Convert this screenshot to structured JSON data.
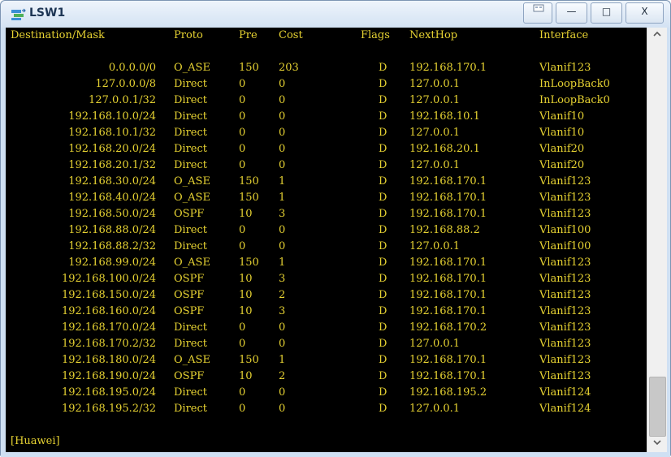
{
  "window": {
    "title": "LSW1",
    "controls": {
      "minimize": "—",
      "maximize": "□",
      "close": "X"
    }
  },
  "colors": {
    "terminal_bg": "#000000",
    "terminal_text": "#e6d232",
    "titlebar": "#dce8f5"
  },
  "routing_table": {
    "headers": [
      "Destination/Mask",
      "Proto",
      "Pre",
      "Cost",
      "Flags",
      "NextHop",
      "Interface"
    ],
    "rows": [
      [
        "0.0.0.0/0",
        "O_ASE",
        "150",
        "203",
        "D",
        "192.168.170.1",
        "Vlanif123"
      ],
      [
        "127.0.0.0/8",
        "Direct",
        "0",
        "0",
        "D",
        "127.0.0.1",
        "InLoopBack0"
      ],
      [
        "127.0.0.1/32",
        "Direct",
        "0",
        "0",
        "D",
        "127.0.0.1",
        "InLoopBack0"
      ],
      [
        "192.168.10.0/24",
        "Direct",
        "0",
        "0",
        "D",
        "192.168.10.1",
        "Vlanif10"
      ],
      [
        "192.168.10.1/32",
        "Direct",
        "0",
        "0",
        "D",
        "127.0.0.1",
        "Vlanif10"
      ],
      [
        "192.168.20.0/24",
        "Direct",
        "0",
        "0",
        "D",
        "192.168.20.1",
        "Vlanif20"
      ],
      [
        "192.168.20.1/32",
        "Direct",
        "0",
        "0",
        "D",
        "127.0.0.1",
        "Vlanif20"
      ],
      [
        "192.168.30.0/24",
        "O_ASE",
        "150",
        "1",
        "D",
        "192.168.170.1",
        "Vlanif123"
      ],
      [
        "192.168.40.0/24",
        "O_ASE",
        "150",
        "1",
        "D",
        "192.168.170.1",
        "Vlanif123"
      ],
      [
        "192.168.50.0/24",
        "OSPF",
        "10",
        "3",
        "D",
        "192.168.170.1",
        "Vlanif123"
      ],
      [
        "192.168.88.0/24",
        "Direct",
        "0",
        "0",
        "D",
        "192.168.88.2",
        "Vlanif100"
      ],
      [
        "192.168.88.2/32",
        "Direct",
        "0",
        "0",
        "D",
        "127.0.0.1",
        "Vlanif100"
      ],
      [
        "192.168.99.0/24",
        "O_ASE",
        "150",
        "1",
        "D",
        "192.168.170.1",
        "Vlanif123"
      ],
      [
        "192.168.100.0/24",
        "OSPF",
        "10",
        "3",
        "D",
        "192.168.170.1",
        "Vlanif123"
      ],
      [
        "192.168.150.0/24",
        "OSPF",
        "10",
        "2",
        "D",
        "192.168.170.1",
        "Vlanif123"
      ],
      [
        "192.168.160.0/24",
        "OSPF",
        "10",
        "3",
        "D",
        "192.168.170.1",
        "Vlanif123"
      ],
      [
        "192.168.170.0/24",
        "Direct",
        "0",
        "0",
        "D",
        "192.168.170.2",
        "Vlanif123"
      ],
      [
        "192.168.170.2/32",
        "Direct",
        "0",
        "0",
        "D",
        "127.0.0.1",
        "Vlanif123"
      ],
      [
        "192.168.180.0/24",
        "O_ASE",
        "150",
        "1",
        "D",
        "192.168.170.1",
        "Vlanif123"
      ],
      [
        "192.168.190.0/24",
        "OSPF",
        "10",
        "2",
        "D",
        "192.168.170.1",
        "Vlanif123"
      ],
      [
        "192.168.195.0/24",
        "Direct",
        "0",
        "0",
        "D",
        "192.168.195.2",
        "Vlanif124"
      ],
      [
        "192.168.195.2/32",
        "Direct",
        "0",
        "0",
        "D",
        "127.0.0.1",
        "Vlanif124"
      ]
    ]
  },
  "prompt": "[Huawei]",
  "scrollbar": {
    "up_icon": "chevron-up-icon",
    "down_icon": "chevron-down-icon"
  }
}
